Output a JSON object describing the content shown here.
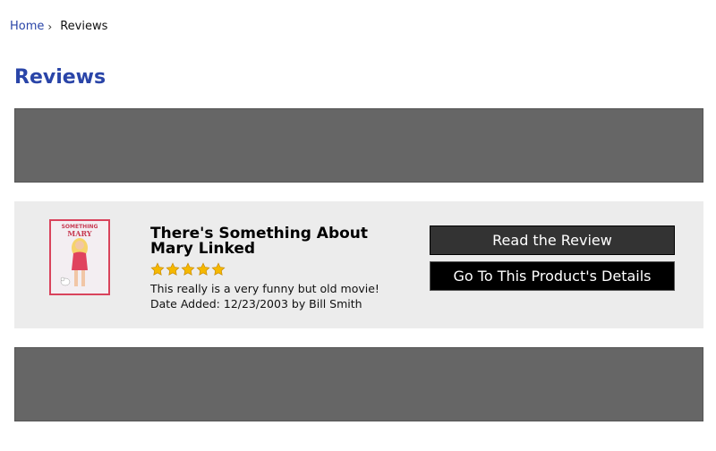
{
  "breadcrumb": {
    "home": "Home",
    "separator": "›",
    "current": "Reviews"
  },
  "page": {
    "title": "Reviews"
  },
  "review": {
    "product_title": "There's Something About Mary Linked",
    "poster_text_top": "SOMETHING",
    "poster_text_mid": "MARY",
    "rating": 5,
    "rating_max": 5,
    "text": "This really is a very funny but old movie!",
    "date_line": "Date Added: 12/23/2003 by Bill Smith",
    "read_button": "Read the Review",
    "details_button": "Go To This Product's Details"
  },
  "colors": {
    "link": "#2a45a8",
    "banner": "#666666",
    "card_bg": "#ececec",
    "star": "#f5b800"
  }
}
